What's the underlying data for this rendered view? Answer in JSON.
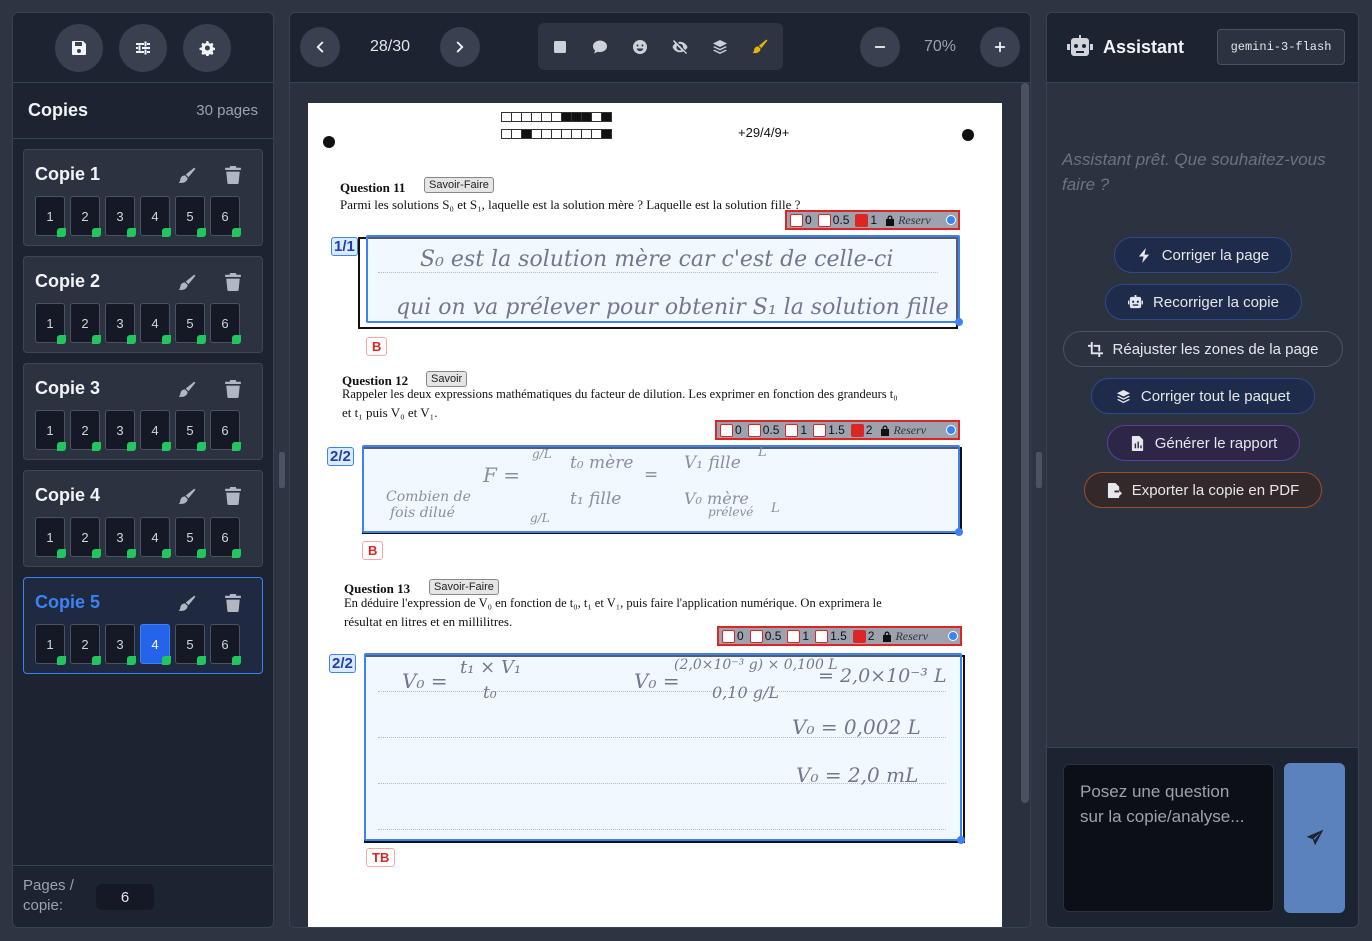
{
  "left_panel": {
    "copies_title": "Copies",
    "copies_count": "30 pages",
    "copies": [
      {
        "name": "Copie 1",
        "pages": [
          "1",
          "2",
          "3",
          "4",
          "5",
          "6"
        ],
        "active_page": null
      },
      {
        "name": "Copie 2",
        "pages": [
          "1",
          "2",
          "3",
          "4",
          "5",
          "6"
        ],
        "active_page": null
      },
      {
        "name": "Copie 3",
        "pages": [
          "1",
          "2",
          "3",
          "4",
          "5",
          "6"
        ],
        "active_page": null
      },
      {
        "name": "Copie 4",
        "pages": [
          "1",
          "2",
          "3",
          "4",
          "5",
          "6"
        ],
        "active_page": null
      },
      {
        "name": "Copie 5",
        "pages": [
          "1",
          "2",
          "3",
          "4",
          "5",
          "6"
        ],
        "active_page": "4"
      }
    ],
    "active_copy": "Copie 5",
    "pages_per_copy_label": "Pages / copie:",
    "pages_per_copy_value": "6"
  },
  "viewer": {
    "page_indicator": "28/30",
    "zoom": "70%",
    "tools": [
      "square-icon",
      "comment-icon",
      "smile-icon",
      "eye-slash-icon",
      "layers-icon",
      "brush-icon"
    ],
    "active_tool": "brush-icon"
  },
  "paper": {
    "page_code": "+29/4/9+",
    "questions": [
      {
        "title": "Question 11",
        "tag": "Savoir-Faire",
        "text": "Parmi les solutions S₀ et S₁, laquelle est la solution mère ? Laquelle est la solution fille ?",
        "score": "1/1",
        "grade": "B",
        "scale": [
          "0",
          "0.5",
          "1"
        ],
        "checked": "1",
        "reserve": "Reserv",
        "handwriting": [
          "S₀ est la solution mère car c'est de celle-ci",
          "qui on va prélever pour obtenir S₁ la solution fille"
        ]
      },
      {
        "title": "Question 12",
        "tag": "Savoir",
        "text_lines": [
          "Rappeler les deux expressions mathématiques du facteur de dilution. Les exprimer en fonction des grandeurs t₀",
          "et t₁ puis V₀ et V₁."
        ],
        "score": "2/2",
        "grade": "B",
        "scale": [
          "0",
          "0.5",
          "1",
          "1.5",
          "2"
        ],
        "checked": "2",
        "reserve": "Reserv",
        "handwriting": [
          "F =",
          "g/L",
          "t₀ mère",
          "t₁ fille",
          "g/L",
          "=",
          "V₁ fille",
          "V₀ mère",
          "prélevé",
          "L",
          "L",
          "Combien de",
          "fois dilué"
        ]
      },
      {
        "title": "Question 13",
        "tag": "Savoir-Faire",
        "text_lines": [
          "En déduire l'expression de V₀ en fonction de t₀, t₁ et V₁, puis faire l'application numérique. On exprimera le",
          "résultat en litres et en millilitres."
        ],
        "score": "2/2",
        "grade": "TB",
        "scale": [
          "0",
          "0.5",
          "1",
          "1.5",
          "2"
        ],
        "checked": "2",
        "reserve": "Reserv",
        "handwriting": [
          "V₀ =",
          "t₁ × V₁",
          "t₀",
          "V₀ =",
          "(2,0×10⁻³ g) × 0,100 L",
          "0,10 g/L",
          "= 2,0×10⁻³ L",
          "V₀ = 0,002 L",
          "V₀ = 2,0 mL"
        ]
      }
    ]
  },
  "assistant": {
    "title": "Assistant",
    "model": "gemini-3-flash",
    "ready_message": "Assistant prêt. Que souhaitez-vous faire ?",
    "actions": [
      {
        "label": "Corriger la page",
        "icon": "bolt-icon"
      },
      {
        "label": "Recorriger la copie",
        "icon": "robot-icon"
      },
      {
        "label": "Réajuster les zones de la page",
        "icon": "crop-icon"
      },
      {
        "label": "Corriger tout le paquet",
        "icon": "layers-icon"
      },
      {
        "label": "Générer le rapport",
        "icon": "file-chart-icon"
      },
      {
        "label": "Exporter la copie en PDF",
        "icon": "file-export-icon"
      }
    ],
    "chat_placeholder": "Posez une question sur la copie/analyse..."
  }
}
